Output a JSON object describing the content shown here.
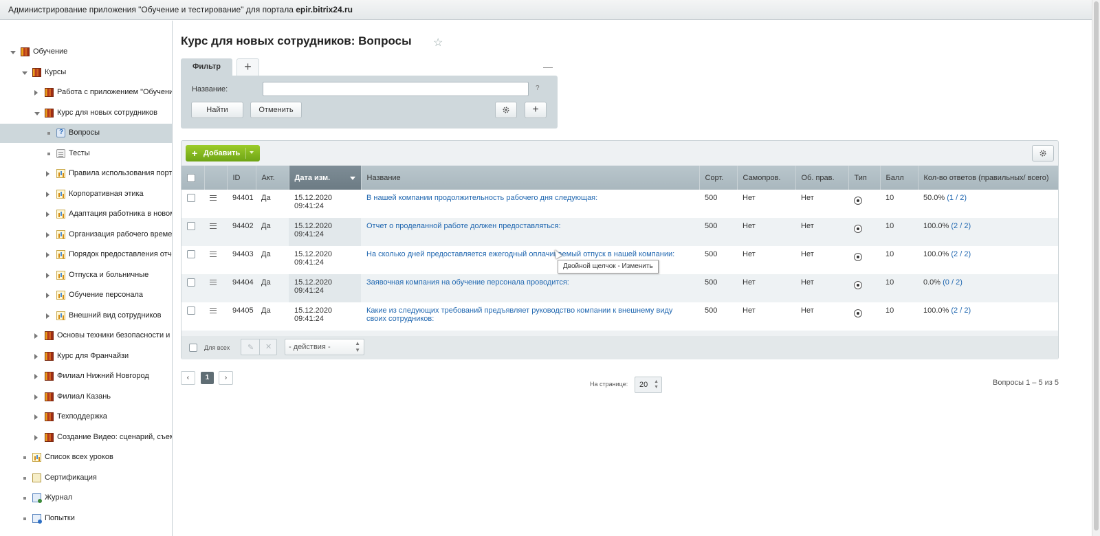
{
  "header": {
    "title_prefix": "Администрирование приложения \"Обучение и тестирование\" для портала ",
    "portal": "epir.bitrix24.ru"
  },
  "sidebar": {
    "items": [
      {
        "label": "Обучение",
        "icon": "book-icon",
        "level": 0,
        "expander": "down",
        "selected": false
      },
      {
        "label": "Курсы",
        "icon": "book-icon",
        "level": 1,
        "expander": "down",
        "selected": false
      },
      {
        "label": "Работа с приложением \"Обучение и тестирование\"",
        "icon": "book-icon",
        "level": 2,
        "expander": "right",
        "selected": false
      },
      {
        "label": "Курс для новых сотрудников",
        "icon": "book-icon",
        "level": 2,
        "expander": "down",
        "selected": false
      },
      {
        "label": "Вопросы",
        "icon": "question-icon",
        "level": 3,
        "expander": "bullet",
        "selected": true
      },
      {
        "label": "Тесты",
        "icon": "test-icon",
        "level": 3,
        "expander": "bullet",
        "selected": false
      },
      {
        "label": "Правила использования портала",
        "icon": "chart-icon",
        "level": 3,
        "expander": "right",
        "selected": false
      },
      {
        "label": "Корпоративная этика",
        "icon": "chart-icon",
        "level": 3,
        "expander": "right",
        "selected": false
      },
      {
        "label": "Адаптация работника в новом коллективе",
        "icon": "chart-icon",
        "level": 3,
        "expander": "right",
        "selected": false
      },
      {
        "label": "Организация рабочего времени",
        "icon": "chart-icon",
        "level": 3,
        "expander": "right",
        "selected": false
      },
      {
        "label": "Порядок предоставления отчетности",
        "icon": "chart-icon",
        "level": 3,
        "expander": "right",
        "selected": false
      },
      {
        "label": "Отпуска и больничные",
        "icon": "chart-icon",
        "level": 3,
        "expander": "right",
        "selected": false
      },
      {
        "label": "Обучение персонала",
        "icon": "chart-icon",
        "level": 3,
        "expander": "right",
        "selected": false
      },
      {
        "label": "Внешний вид сотрудников",
        "icon": "chart-icon",
        "level": 3,
        "expander": "right",
        "selected": false
      },
      {
        "label": "Основы техники безопасности и охраны труда",
        "icon": "book-icon",
        "level": 2,
        "expander": "right",
        "selected": false
      },
      {
        "label": "Курс для Франчайзи",
        "icon": "book-icon",
        "level": 2,
        "expander": "right",
        "selected": false
      },
      {
        "label": "Филиал Нижний Новгород",
        "icon": "book-icon",
        "level": 2,
        "expander": "right",
        "selected": false
      },
      {
        "label": "Филиал Казань",
        "icon": "book-icon",
        "level": 2,
        "expander": "right",
        "selected": false
      },
      {
        "label": "Техподдержка",
        "icon": "book-icon",
        "level": 2,
        "expander": "right",
        "selected": false
      },
      {
        "label": "Создание Видео: сценарий, съемка, монтаж",
        "icon": "book-icon",
        "level": 2,
        "expander": "right",
        "selected": false
      },
      {
        "label": "Список всех уроков",
        "icon": "chart-icon",
        "level": 1,
        "expander": "bullet",
        "selected": false
      },
      {
        "label": "Сертификация",
        "icon": "certificate-icon",
        "level": 1,
        "expander": "bullet",
        "selected": false
      },
      {
        "label": "Журнал",
        "icon": "journal-icon",
        "level": 1,
        "expander": "bullet",
        "selected": false
      },
      {
        "label": "Попытки",
        "icon": "attempts-icon",
        "level": 1,
        "expander": "bullet",
        "selected": false
      }
    ]
  },
  "page": {
    "title": "Курс для новых сотрудников: Вопросы"
  },
  "filter": {
    "tab_label": "Фильтр",
    "add_tab": "+",
    "minimize": "—",
    "name_label": "Название:",
    "name_value": "",
    "help": "?",
    "find_label": "Найти",
    "cancel_label": "Отменить",
    "add_field": "+"
  },
  "toolbar": {
    "add_label": "Добавить",
    "add_plus": "+"
  },
  "grid": {
    "columns": [
      "",
      "",
      "ID",
      "Акт.",
      "Дата изм.",
      "Название",
      "Сорт.",
      "Самопров.",
      "Об. прав.",
      "Тип",
      "Балл",
      "Кол-во ответов (правильных/ всего)"
    ],
    "rows": [
      {
        "id": "94401",
        "active": "Да",
        "date": "15.12.2020",
        "time": "09:41:24",
        "name": "В нашей компании продолжительность рабочего дня следующая:",
        "sort": "500",
        "self_check": "Нет",
        "correct_required": "Нет",
        "score": "10",
        "answers_pct": "50.0%",
        "answers_ratio": "(1 / 2)"
      },
      {
        "id": "94402",
        "active": "Да",
        "date": "15.12.2020",
        "time": "09:41:24",
        "name": "Отчет о проделанной работе должен предоставляться:",
        "sort": "500",
        "self_check": "Нет",
        "correct_required": "Нет",
        "score": "10",
        "answers_pct": "100.0%",
        "answers_ratio": "(2 / 2)"
      },
      {
        "id": "94403",
        "active": "Да",
        "date": "15.12.2020",
        "time": "09:41:24",
        "name": "На сколько дней предоставляется ежегодный оплачиваемый отпуск в нашей компании:",
        "sort": "500",
        "self_check": "Нет",
        "correct_required": "Нет",
        "score": "10",
        "answers_pct": "100.0%",
        "answers_ratio": "(2 / 2)"
      },
      {
        "id": "94404",
        "active": "Да",
        "date": "15.12.2020",
        "time": "09:41:24",
        "name": "Заявочная компания на обучение персонала проводится:",
        "sort": "500",
        "self_check": "Нет",
        "correct_required": "Нет",
        "score": "10",
        "answers_pct": "0.0%",
        "answers_ratio": "(0 / 2)"
      },
      {
        "id": "94405",
        "active": "Да",
        "date": "15.12.2020",
        "time": "09:41:24",
        "name": "Какие из следующих требований предъявляет руководство компании к внешнему виду своих сотрудников:",
        "sort": "500",
        "self_check": "Нет",
        "correct_required": "Нет",
        "score": "10",
        "answers_pct": "100.0%",
        "answers_ratio": "(2 / 2)"
      }
    ],
    "footer": {
      "for_all": "Для всех",
      "actions_placeholder": "- действия -"
    }
  },
  "pagination": {
    "prev": "‹",
    "current": "1",
    "next": "›",
    "per_page_label": "На странице:",
    "per_page": "20",
    "summary": "Вопросы 1 – 5 из 5"
  },
  "tooltip": {
    "text": "Двойной щелчок - Изменить"
  },
  "colors": {
    "accent_green": "#7cb518",
    "link_blue": "#2067b0",
    "header_grey": "#b3c0c6"
  }
}
